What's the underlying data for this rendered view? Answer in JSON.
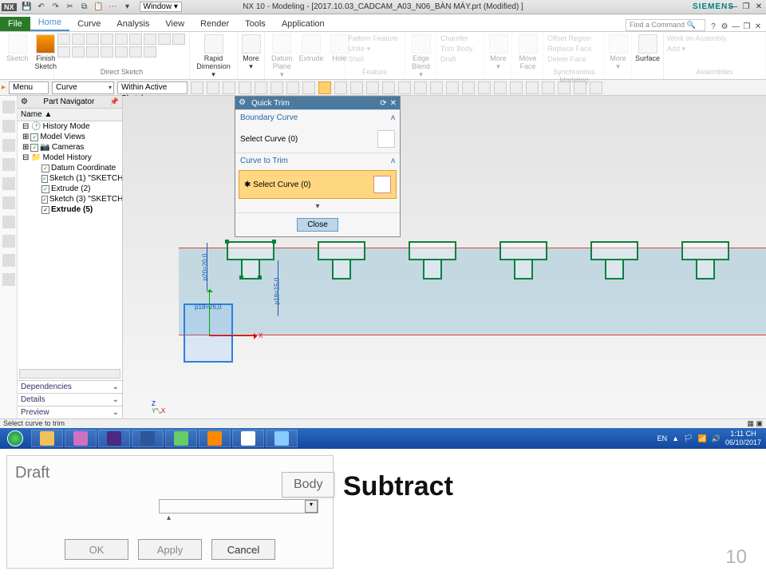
{
  "title_bar": {
    "nx": "NX",
    "qat_icons": [
      "save",
      "undo",
      "↶",
      "↷",
      "cut",
      "copy",
      "paste",
      "⋯",
      "⇩"
    ],
    "window_selector": "Window ▾",
    "doc_title": "NX 10 - Modeling - [2017.10.03_CADCAM_A03_N06_BÀN MÁY.prt (Modified) ]",
    "brand": "SIEMENS",
    "win_min": "—",
    "win_max": "❐",
    "win_close": "✕"
  },
  "ribbon": {
    "tabs": {
      "file": "File",
      "home": "Home",
      "curve": "Curve",
      "analysis": "Analysis",
      "view": "View",
      "render": "Render",
      "tools": "Tools",
      "application": "Application"
    },
    "find_placeholder": "Find a Command",
    "groups": {
      "direct_sketch": "Direct Sketch",
      "feature": "Feature",
      "sync": "Synchronous Modeling",
      "assemblies": "Assemblies"
    },
    "cmds": {
      "sketch": "Sketch",
      "finish_sketch": "Finish\nSketch",
      "rapid_dimension": "Rapid\nDimension ▾",
      "more1": "More\n▾",
      "datum_plane": "Datum\nPlane ▾",
      "extrude": "Extrude",
      "hole": "Hole",
      "pattern": "Pattern Feature",
      "unite": "Unite ▾",
      "shell": "Shell",
      "edge_blend": "Edge\nBlend ▾",
      "chamfer": "Chamfer",
      "trim_body": "Trim Body",
      "draft": "Draft",
      "more2": "More\n▾",
      "move_face": "Move\nFace",
      "offset_region": "Offset Region",
      "replace_face": "Replace Face",
      "delete_face": "Delete Face",
      "more3": "More\n▾",
      "surface": "Surface",
      "work_asm": "Work on Assembly",
      "add": "Add ▾"
    }
  },
  "sel_bar": {
    "menu": "Menu ▾",
    "filter": "Curve",
    "scope": "Within Active Sketch"
  },
  "part_nav": {
    "title": "Part Navigator",
    "col": "Name   ▲",
    "items": {
      "history_mode": "History Mode",
      "model_views": "Model Views",
      "cameras": "Cameras",
      "model_history": "Model History",
      "datum": "Datum Coordinate",
      "sk1": "Sketch (1) \"SKETCH",
      "ext2": "Extrude (2)",
      "sk3": "Sketch (3) \"SKETCH",
      "ext5": "Extrude (5)"
    },
    "sections": {
      "deps": "Dependencies",
      "details": "Details",
      "preview": "Preview"
    }
  },
  "quick_trim": {
    "title": "Quick Trim",
    "boundary": "Boundary Curve",
    "select_curve_0": "Select Curve (0)",
    "curve_to_trim": "Curve to Trim",
    "select_curve_0b": "Select Curve (0)",
    "close": "Close"
  },
  "dimensions": {
    "d1": "p20=20,0",
    "d2": "p18=26,0",
    "d3": "p18=15,0"
  },
  "axes": {
    "x": "X",
    "y": "Y",
    "z": "Z"
  },
  "status": {
    "msg": "Select curve to trim"
  },
  "taskbar": {
    "lang": "EN",
    "time": "1:11 CH",
    "date": "06/10/2017"
  },
  "lower": {
    "draft": "Draft",
    "body": "Body",
    "ok": "OK",
    "apply": "Apply",
    "cancel": "Cancel",
    "subtract": "Subtract",
    "page": "10"
  }
}
